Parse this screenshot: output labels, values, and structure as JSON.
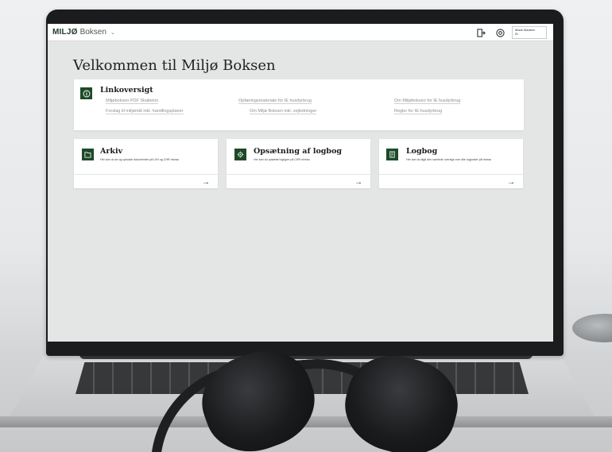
{
  "app": {
    "brand_strong": "MILJØ",
    "brand_light": "Boksen",
    "chevron": "⌄",
    "user_line1": "Mads Madsen",
    "user_line2": "ID"
  },
  "page": {
    "title": "Velkommen til Miljø Boksen"
  },
  "links_card": {
    "title": "Linkoversigt",
    "icon": "info-icon",
    "links": [
      "Miljøboksen PDF Skabelon",
      "Forslag til miljømål inkl. handlingsplaner",
      "Opfæringsmateriale for IE husdyrbrug",
      "Om Miljø Boksen inkl. vejledninger",
      "Om Miljøboksen for IE husdyrbrug",
      "Regler for IE-husdyrbrug"
    ]
  },
  "cards": [
    {
      "title": "Arkiv",
      "desc": "Her kan du se og uploade dokumenter på LVH og CHR niveau",
      "icon": "folder-icon",
      "arrow": "→"
    },
    {
      "title": "Opsætning af logbog",
      "desc": "Her kan du opsætte logtyper på CHR niveau",
      "icon": "gear-icon",
      "arrow": "→"
    },
    {
      "title": "Logbog",
      "desc": "Her kan du tilgå den samlede oversigt over alle logposter på niveau",
      "icon": "logbook-icon",
      "arrow": "→"
    }
  ]
}
